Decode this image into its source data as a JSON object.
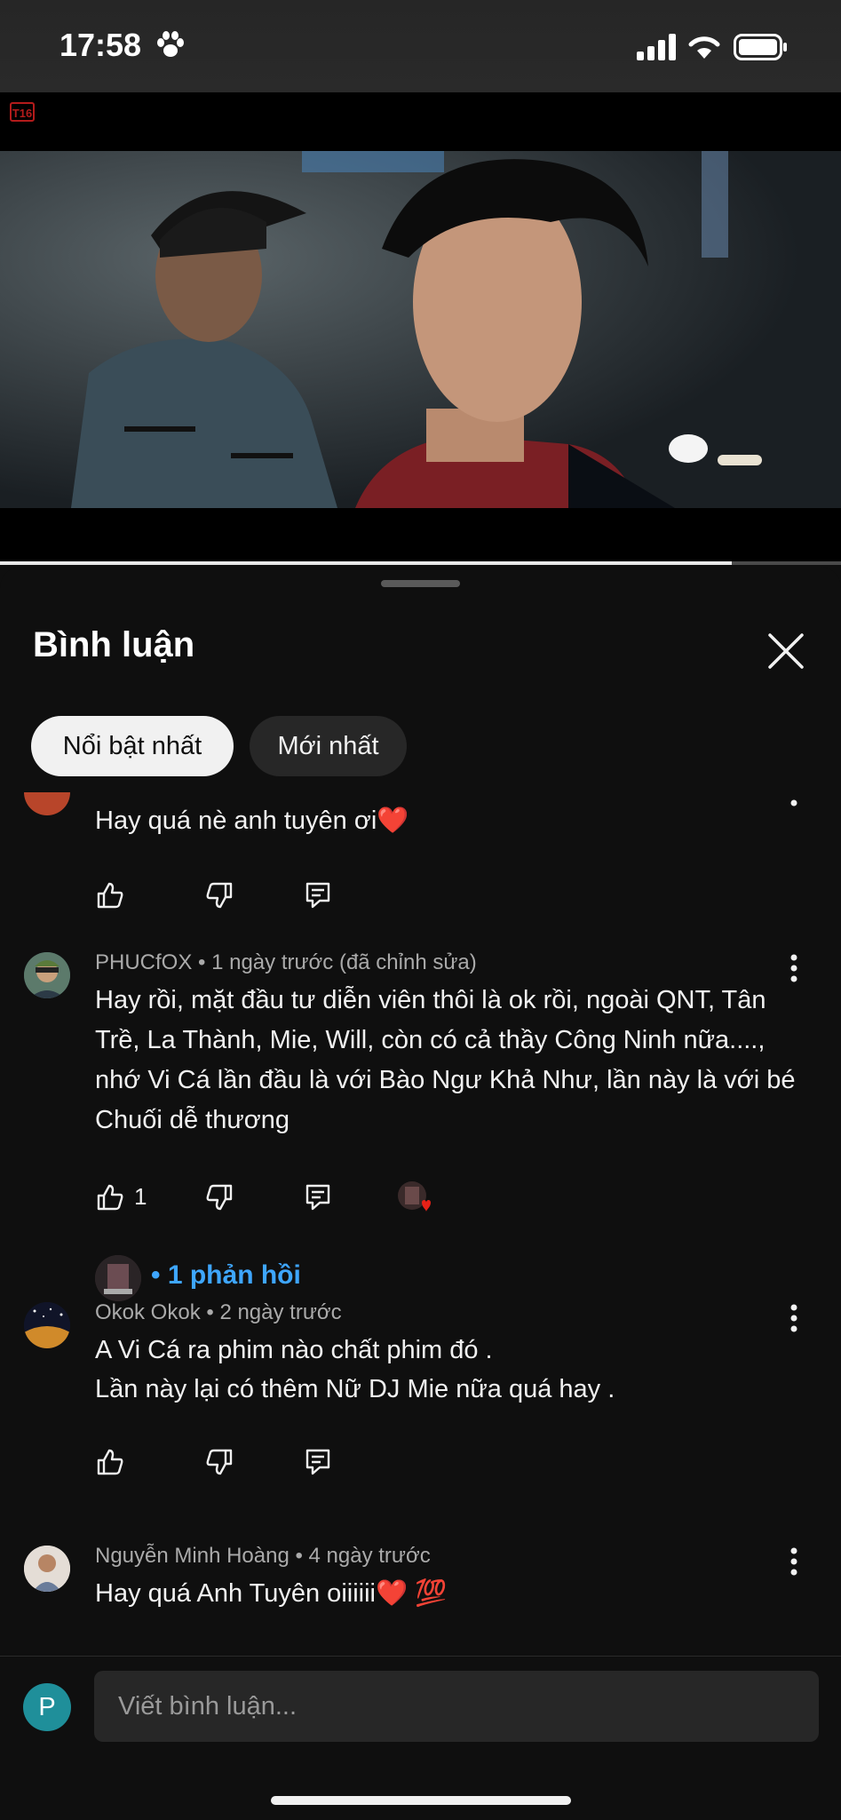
{
  "status_bar": {
    "time": "17:58"
  },
  "video": {
    "rating": "T16",
    "progress_fraction": 0.87
  },
  "sheet": {
    "title": "Bình luận",
    "filters": [
      "Nổi bật nhất",
      "Mới nhất"
    ]
  },
  "comments": [
    {
      "author": "",
      "meta": "",
      "text": "Hay quá nè anh tuyên ơi❤️"
    },
    {
      "author": "PHUCfOX",
      "meta": "PHUCfOX • 1 ngày trước (đã chỉnh sửa)",
      "text": "Hay rồi, mặt đầu tư diễn viên thôi là ok rồi, ngoài QNT, Tân Trề, La Thành, Mie, Will, còn có cả thầy Công Ninh nữa...., nhớ Vi Cá lần đầu là với Bào Ngư Khả Như, lần này là với bé Chuối dễ thương",
      "likes": "1",
      "replies_label": "• 1 phản hồi"
    },
    {
      "author": "Okok Okok",
      "meta": "Okok Okok • 2 ngày trước",
      "text_lines": [
        "A Vi Cá ra phim nào chất phim đó .",
        "Lần này lại có thêm Nữ DJ Mie nữa quá hay ."
      ]
    },
    {
      "author": "Nguyễn Minh Hoàng",
      "meta": "Nguyễn Minh Hoàng • 4 ngày trước",
      "text": "Hay quá Anh Tuyên oiiiiii❤️ 💯"
    }
  ],
  "composer": {
    "avatar_letter": "P",
    "placeholder": "Viết bình luận..."
  },
  "colors": {
    "background": "#0f0f0f",
    "chip_active": "#f1f1f1",
    "link_blue": "#3ea6ff",
    "heart_red": "#e62117"
  }
}
